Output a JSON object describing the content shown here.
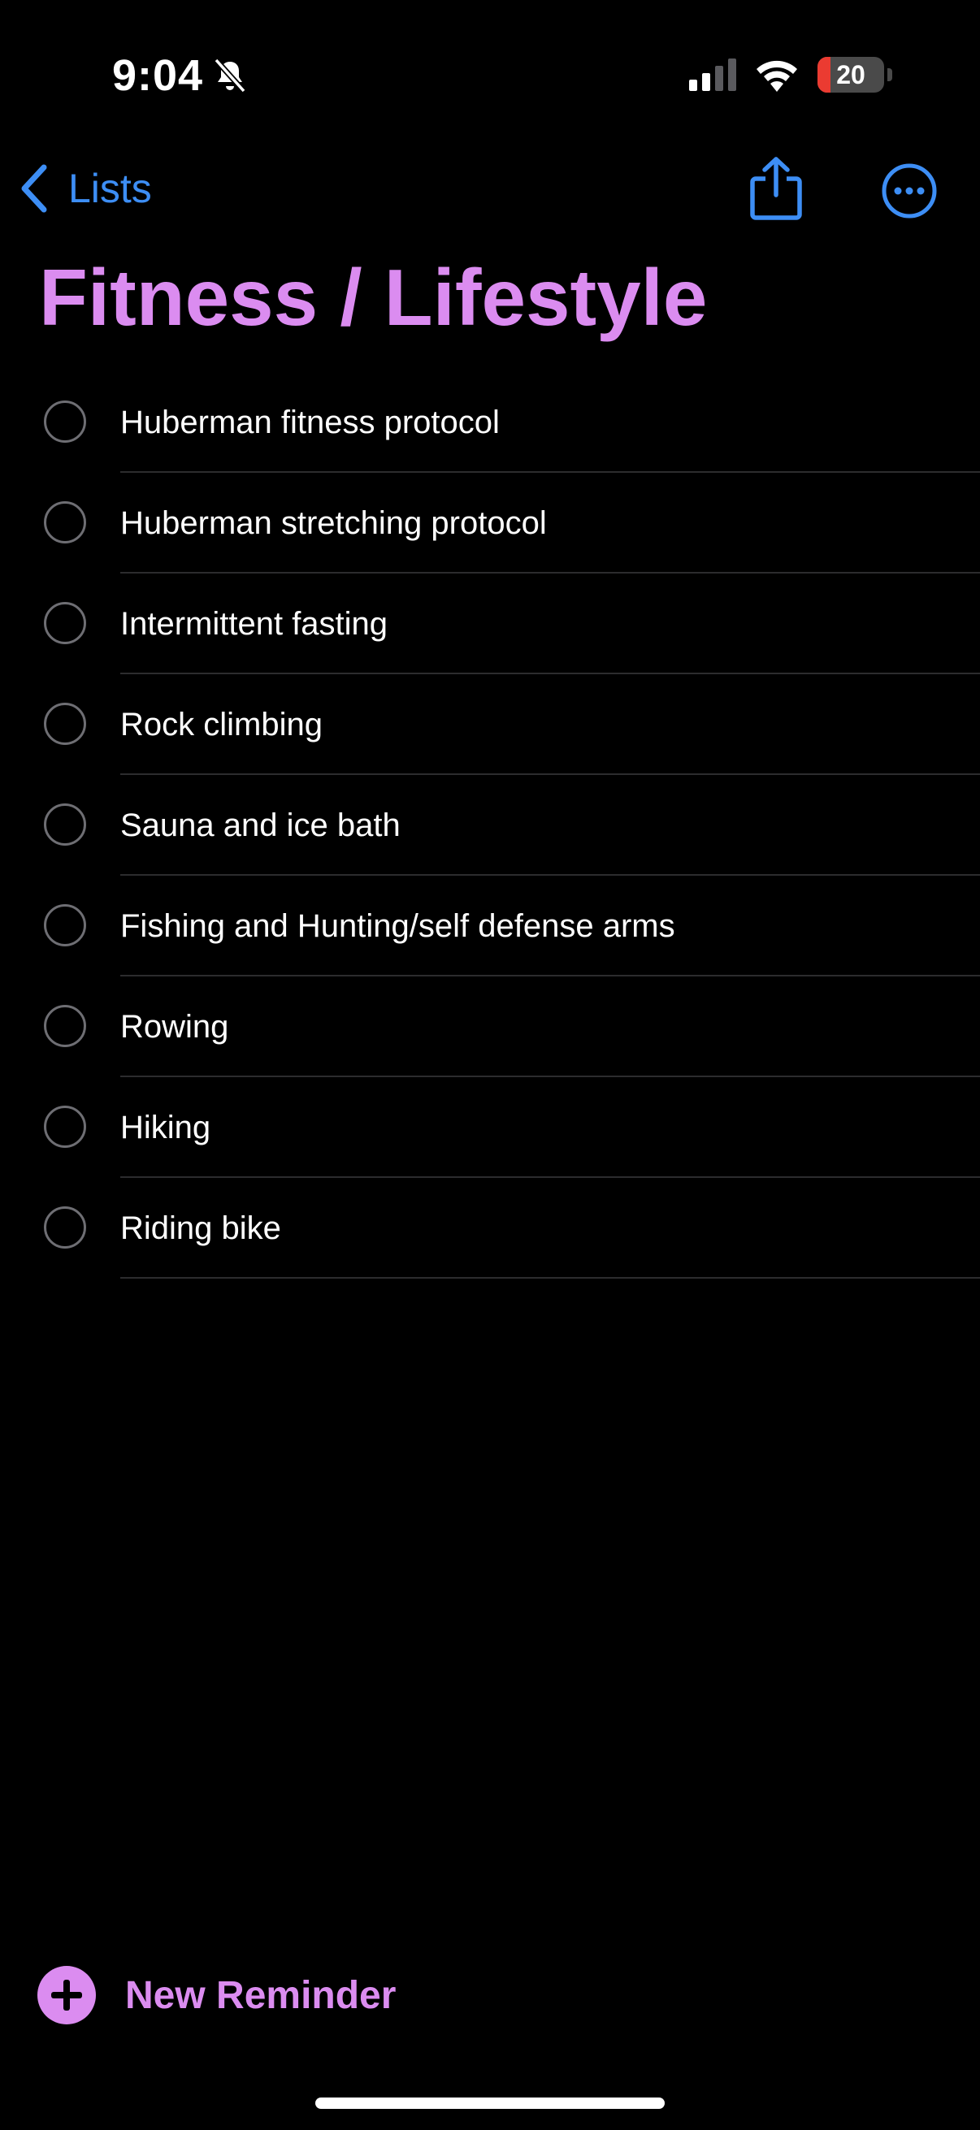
{
  "status_bar": {
    "time": "9:04",
    "mute_icon": "bell-slash-icon",
    "signal_icon": "cellular-signal-icon",
    "wifi_icon": "wifi-icon",
    "battery_level": "20",
    "battery_color": "#eb3b31"
  },
  "nav": {
    "back_label": "Lists",
    "back_icon": "chevron-left-icon",
    "share_icon": "share-icon",
    "more_icon": "ellipsis-circle-icon",
    "accent_color": "#3d8ef5"
  },
  "list": {
    "title": "Fitness / Lifestyle",
    "color": "#db8cf0",
    "items": [
      {
        "label": "Huberman fitness protocol"
      },
      {
        "label": "Huberman stretching protocol"
      },
      {
        "label": "Intermittent fasting"
      },
      {
        "label": "Rock climbing"
      },
      {
        "label": "Sauna and ice bath"
      },
      {
        "label": "Fishing and Hunting/self defense arms"
      },
      {
        "label": "Rowing"
      },
      {
        "label": "Hiking"
      },
      {
        "label": "Riding bike"
      }
    ]
  },
  "footer": {
    "new_reminder_label": "New Reminder",
    "new_reminder_icon": "plus-circle-icon"
  }
}
